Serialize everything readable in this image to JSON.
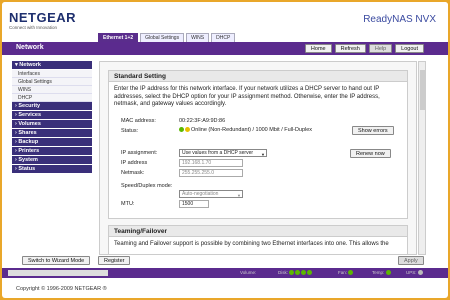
{
  "brand": {
    "logo": "NETGEAR",
    "tagline": "Connect with Innovation",
    "product": "ReadyNAS NVX"
  },
  "tabs": [
    {
      "label": "Ethernet 1+2",
      "active": true
    },
    {
      "label": "Global Settings",
      "active": false
    },
    {
      "label": "WINS",
      "active": false
    },
    {
      "label": "DHCP",
      "active": false
    }
  ],
  "nav": {
    "title": "Network",
    "home": "Home",
    "refresh": "Refresh",
    "help": "Help",
    "logout": "Logout"
  },
  "sidebar": {
    "network": "Network",
    "network_items": [
      "Interfaces",
      "Global Settings",
      "WINS",
      "DHCP"
    ],
    "sections": [
      "Security",
      "Services",
      "Volumes",
      "Shares",
      "Backup",
      "Printers",
      "System",
      "Status"
    ]
  },
  "standard": {
    "title": "Standard Setting",
    "description": "Enter the IP address for this network interface. If your network utilizes a DHCP server to hand out IP addresses, select the DHCP option for your IP assignment method. Otherwise, enter the IP address, netmask, and gateway values accordingly.",
    "mac_label": "MAC address:",
    "mac_value": "00:22:3F:A9:9D:86",
    "status_label": "Status:",
    "status_value": "Online (Non-Redundant) / 1000 Mbit / Full-Duplex",
    "show_errors": "Show errors",
    "ip_assign_label": "IP assignment:",
    "ip_assign_value": "Use values from a DHCP server",
    "renew": "Renew now",
    "ip_label": "IP address",
    "ip_value": "192.168.1.70",
    "netmask_label": "Netmask:",
    "netmask_value": "255.255.255.0",
    "speed_label": "Speed/Duplex mode:",
    "speed_value": "Auto-negotiation",
    "mtu_label": "MTU:",
    "mtu_value": "1500"
  },
  "teaming": {
    "title": "Teaming/Failover",
    "description": "Teaming and Failover support is possible by combining two Ethernet interfaces into one. This allows the"
  },
  "bottom": {
    "wizard": "Switch to Wizard Mode",
    "register": "Register",
    "apply": "Apply"
  },
  "statusbar": {
    "volume": "Volume:",
    "disk": "Disk:",
    "fan": "Fan:",
    "temp": "Temp:",
    "ups": "UPS:"
  },
  "footer": "Copyright © 1996-2009 NETGEAR ®",
  "colors": {
    "purple": "#5b2b8e",
    "online_green": "#5cb800",
    "online_yellow": "#e8c000"
  }
}
